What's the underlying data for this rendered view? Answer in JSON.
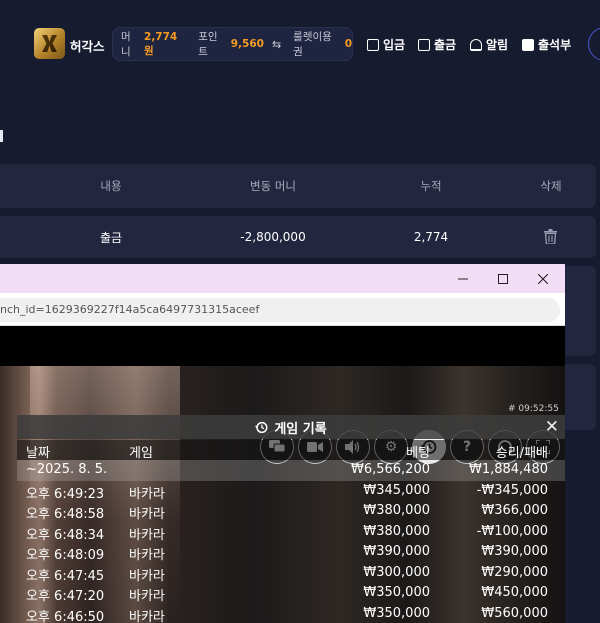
{
  "header": {
    "brand": "허각스",
    "wallet": {
      "money_label": "머니",
      "money_value": "2,774원",
      "point_label": "포인트",
      "point_value": "9,560",
      "swap_symbol": "⇆",
      "roulette_label": "룰렛이용권",
      "roulette_value": "0"
    },
    "nav": {
      "deposit": "입금",
      "withdraw": "출금",
      "alarm": "알림",
      "attendance": "출석부"
    }
  },
  "history_table": {
    "columns": [
      "내용",
      "변동 머니",
      "누적",
      "삭제"
    ],
    "rows": [
      {
        "content": "출금",
        "change": "-2,800,000",
        "cumulative": "2,774"
      }
    ]
  },
  "window": {
    "address": "nch_id=1629369227f14a5ca6497731315aceef",
    "controls": [
      "chat-icon",
      "video-icon",
      "volume-icon",
      "gear-icon",
      "history-icon",
      "help-icon",
      "headset-icon",
      "fullscreen-icon"
    ],
    "time": "# 09:52:55",
    "game_history": {
      "title": "게임 기록",
      "columns": [
        "날짜",
        "게임",
        "베팅",
        "승리/패배"
      ],
      "total": {
        "date": "~2025. 8. 5.",
        "game": "",
        "bet": "₩6,566,200",
        "result": "₩1,884,480"
      },
      "rows": [
        {
          "date": "오후 6:49:23",
          "game": "바카라",
          "bet": "₩345,000",
          "result": "-₩345,000"
        },
        {
          "date": "오후 6:48:58",
          "game": "바카라",
          "bet": "₩380,000",
          "result": "₩366,000"
        },
        {
          "date": "오후 6:48:34",
          "game": "바카라",
          "bet": "₩380,000",
          "result": "-₩100,000"
        },
        {
          "date": "오후 6:48:09",
          "game": "바카라",
          "bet": "₩390,000",
          "result": "₩390,000"
        },
        {
          "date": "오후 6:47:45",
          "game": "바카라",
          "bet": "₩300,000",
          "result": "₩290,000"
        },
        {
          "date": "오후 6:47:20",
          "game": "바카라",
          "bet": "₩350,000",
          "result": "₩450,000"
        },
        {
          "date": "오후 6:46:50",
          "game": "바카라",
          "bet": "₩350,000",
          "result": "₩560,000"
        }
      ]
    }
  }
}
